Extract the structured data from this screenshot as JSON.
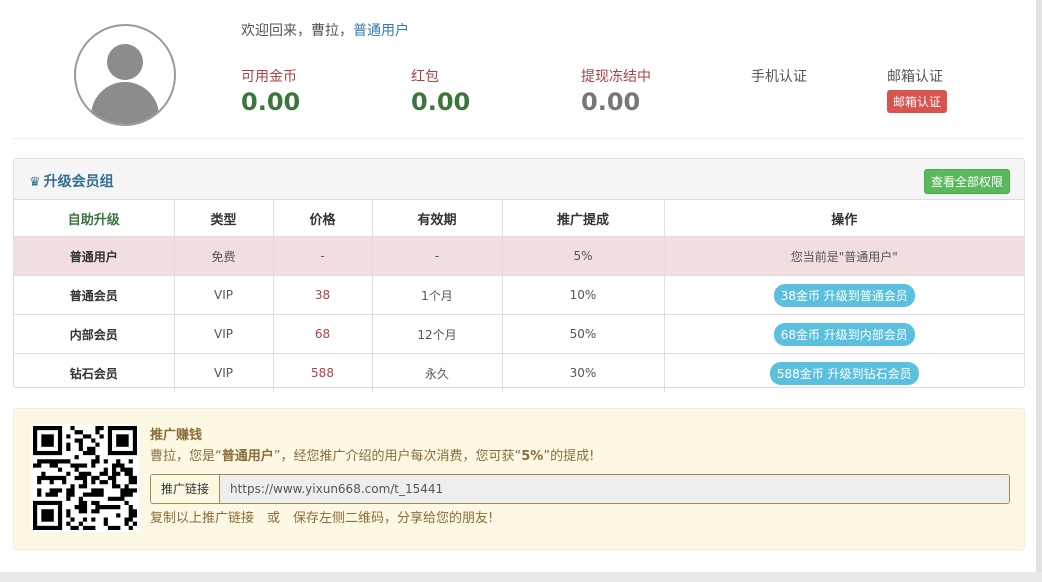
{
  "header": {
    "welcome_prefix": "欢迎回来，曹拉，",
    "user_role": "普通用户",
    "stats": [
      {
        "label": "可用金币",
        "value": "0.00"
      },
      {
        "label": "红包",
        "value": "0.00"
      },
      {
        "label": "提现冻结中",
        "value": "0.00"
      }
    ],
    "phone_verify_label": "手机认证",
    "email_verify_label": "邮箱认证",
    "email_verify_badge": "邮箱认证"
  },
  "upgrade_panel": {
    "icon": "crown-icon",
    "title": "升级会员组",
    "view_all_button": "查看全部权限",
    "columns": [
      "自助升级",
      "类型",
      "价格",
      "有效期",
      "推广提成",
      "操作"
    ],
    "rows": [
      {
        "name": "普通用户",
        "type": "免费",
        "price": "-",
        "period": "-",
        "commission": "5%",
        "action": "您当前是\"普通用户\""
      },
      {
        "name": "普通会员",
        "type": "VIP",
        "price": "38",
        "period": "1个月",
        "commission": "10%",
        "action": "38金币 升级到普通会员"
      },
      {
        "name": "内部会员",
        "type": "VIP",
        "price": "68",
        "period": "12个月",
        "commission": "50%",
        "action": "68金币 升级到内部会员"
      },
      {
        "name": "钻石会员",
        "type": "VIP",
        "price": "588",
        "period": "永久",
        "commission": "30%",
        "action": "588金币 升级到钻石会员"
      }
    ]
  },
  "promo": {
    "title": "推广赚钱",
    "desc_pre": "曹拉，您是“",
    "desc_role": "普通用户",
    "desc_mid": "”，经您推广介绍的用户每次消费，您可获“",
    "desc_rate": "5%",
    "desc_post": "”的提成!",
    "link_label": "推广链接",
    "link_value": "https://www.yixun668.com/t_15441",
    "tip": "复制以上推广链接　或　保存左侧二维码，分享给您的朋友!"
  },
  "colors": {
    "accent_green": "#3c763d",
    "accent_blue": "#31708f",
    "danger": "#d9534f",
    "info": "#5bc0de",
    "warning_bg": "#fcf8e3"
  }
}
